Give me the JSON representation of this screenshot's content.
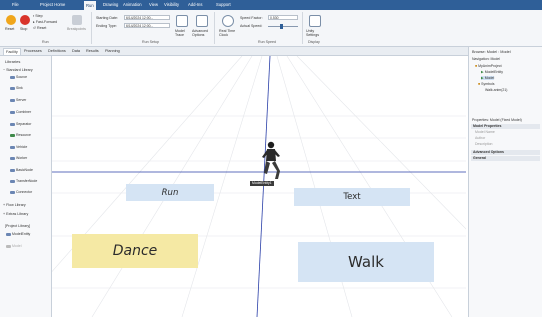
{
  "menu": [
    "File",
    "Project Home",
    "Run",
    "Drawing",
    "Animation",
    "View",
    "Visibility",
    "Add-Ins",
    "Support"
  ],
  "ribbon": {
    "reset": "Reset",
    "stop": "Stop",
    "step": "Step",
    "fast_forward": "Fast-Forward",
    "reset_small": "Reset",
    "breakpoints": "Breakpoints",
    "starting_date_label": "Starting Date:",
    "starting_date_value": "6/14/2024 12:00...",
    "ending_date_label": "Ending Type:",
    "ending_date_value": "6/14/2024 12:00...",
    "model_trace": "Model\nTrace",
    "advanced_options": "Advanced\nOptions",
    "real_time_clock": "Real Time\nClock",
    "speed_factor_label": "Speed Factor:",
    "speed_factor_value": "0.530",
    "actual_speed_label": "Actual Speed:",
    "unity_settings": "Unity\nSettings",
    "group_run": "Run",
    "group_run_setup": "Run Setup",
    "group_run_speed": "Run Speed",
    "group_display": "Display"
  },
  "tabs": [
    "Facility",
    "Processes",
    "Definitions",
    "Data",
    "Results",
    "Planning"
  ],
  "library": {
    "title": "Libraries",
    "standard": "Standard Library",
    "items": [
      "Source",
      "Sink",
      "Server",
      "Combiner",
      "Separator",
      "Resource",
      "Vehicle",
      "Worker",
      "BasicNode",
      "TransferNode",
      "Connector"
    ],
    "flow": "Flow Library",
    "extras": "Extras Library",
    "project": "[Project Library]",
    "project_items": [
      "ModelEntity",
      "Model"
    ]
  },
  "canvas": {
    "tiles": [
      "Run",
      "Text",
      "Dance",
      "Walk"
    ],
    "character_label": "ModelEntity1",
    "colors": {
      "tile_blue": "#d5e4f4",
      "tile_yellow": "#f5e9a4",
      "axis_blue": "#2a3fa8",
      "grid": "#e4e6ea"
    }
  },
  "browser": {
    "title": "Browse: Model : Model",
    "navigation": "Navigation: Model",
    "tree": [
      "MyAnimProject",
      "ModelEntity",
      "Model",
      "Symbols",
      "Walk.anim(21)"
    ],
    "properties_title": "Properties: Model (Fixed Model)",
    "sections": [
      "Model Properties",
      "Advanced Options",
      "General"
    ],
    "model_props": [
      "Model Name",
      "Author",
      "Description"
    ]
  }
}
